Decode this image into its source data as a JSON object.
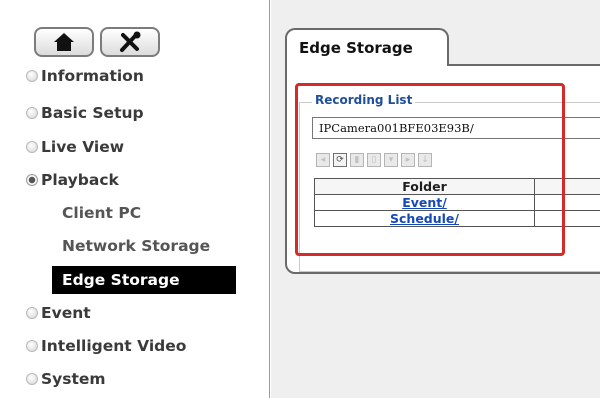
{
  "sidebar": {
    "home_icon": "home-icon",
    "tools_icon": "tools-icon",
    "menu": [
      {
        "label": "Information"
      },
      {
        "label": "Basic Setup"
      },
      {
        "label": "Live View"
      },
      {
        "label": "Playback"
      },
      {
        "label": "Event"
      },
      {
        "label": "Intelligent Video"
      },
      {
        "label": "System"
      }
    ],
    "playback_sub": [
      {
        "label": "Client PC"
      },
      {
        "label": "Network Storage"
      },
      {
        "label": "Edge Storage"
      }
    ]
  },
  "main": {
    "tab_label": "Edge Storage",
    "recording": {
      "legend": "Recording List",
      "path": "IPCamera001BFE03E93B/",
      "toolbar_icons": [
        "back-icon",
        "refresh-icon",
        "delete-icon",
        "copy-icon",
        "download-icon",
        "play-icon",
        "info-icon"
      ],
      "table": {
        "header": "Folder",
        "rows": [
          "Event/",
          "Schedule/"
        ]
      }
    },
    "highlight_color": "#d42a2a"
  }
}
